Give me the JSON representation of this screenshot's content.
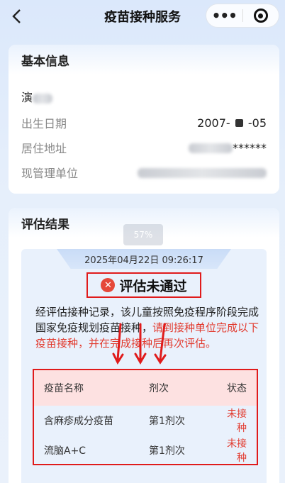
{
  "nav": {
    "title": "疫苗接种服务",
    "back_icon": "chevron-left-icon",
    "more_icon": "more-dots-icon",
    "close_icon": "target-circle-icon"
  },
  "basic": {
    "section_title": "基本信息",
    "name_visible": "演",
    "fields": [
      {
        "label": "出生日期",
        "value_prefix": "2007-",
        "value_suffix": "-05"
      },
      {
        "label": "居住地址",
        "value_suffix": "******"
      },
      {
        "label": "现管理单位",
        "value_suffix": ""
      }
    ]
  },
  "result": {
    "section_title": "评估结果",
    "progress_text": "57%",
    "datetime": "2025年04月22日 09:26:17",
    "status": "评估未通过",
    "desc_normal": "经评估接种记录，该儿童按照免疫程序阶段完成国家免疫规划疫苗接种，",
    "desc_highlight": "请到接种单位完成以下疫苗接种，并在完成接种后再次评估。",
    "table": {
      "headers": [
        "疫苗名称",
        "剂次",
        "状态"
      ],
      "rows": [
        {
          "name": "含麻疹成分疫苗",
          "dose": "第1剂次",
          "status": "未接种"
        },
        {
          "name": "流脑A+C",
          "dose": "第1剂次",
          "status": "未接种"
        }
      ]
    },
    "colors": {
      "alert": "#e01b1b",
      "pending": "#e23a2e",
      "table_header_bg": "#fde1e1"
    }
  }
}
